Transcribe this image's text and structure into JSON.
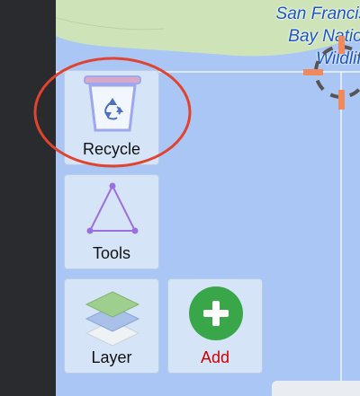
{
  "map": {
    "place_label_lines": [
      "San Francisco",
      "Bay National",
      "Wildlife..."
    ],
    "colors": {
      "water": "#a9c6f5",
      "land": "#cfe3b9",
      "label": "#1a55c4",
      "rail": "#2a2b2e"
    }
  },
  "toolbar": {
    "recycle_label": "Recycle",
    "tools_label": "Tools",
    "layer_label": "Layer",
    "add_label": "Add"
  },
  "icons": {
    "recycle": "recycle-bin-icon",
    "tools": "triangle-polygon-icon",
    "layer": "layers-stack-icon",
    "add": "plus-circle-icon",
    "crosshair": "crosshair-target-icon"
  },
  "accent_colors": {
    "add_label": "#d00000",
    "add_button": "#3aa64a",
    "annotation": "#e0432f",
    "crosshair": "#f08a5d"
  }
}
